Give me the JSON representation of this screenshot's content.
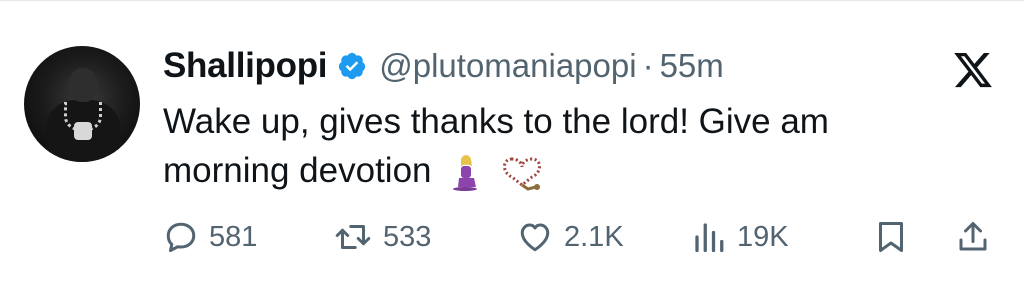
{
  "author": {
    "name": "Shallipopi",
    "handle": "@plutomaniapopi",
    "separator": "·",
    "time": "55m"
  },
  "tweet": {
    "line1": "Wake up, gives thanks to the lord! Give am",
    "line2": "morning devotion",
    "emojis": [
      "woman-kneeling-emoji",
      "prayer-beads-emoji"
    ]
  },
  "actions": {
    "replies": "581",
    "retweets": "533",
    "likes": "2.1K",
    "views": "19K"
  },
  "colors": {
    "verified": "#1d9bf0",
    "secondary_text": "#536471",
    "primary_text": "#0f1419"
  },
  "icons": [
    "x-logo-icon",
    "verified-badge-icon",
    "reply-icon",
    "retweet-icon",
    "like-icon",
    "views-icon",
    "bookmark-icon",
    "share-icon"
  ]
}
